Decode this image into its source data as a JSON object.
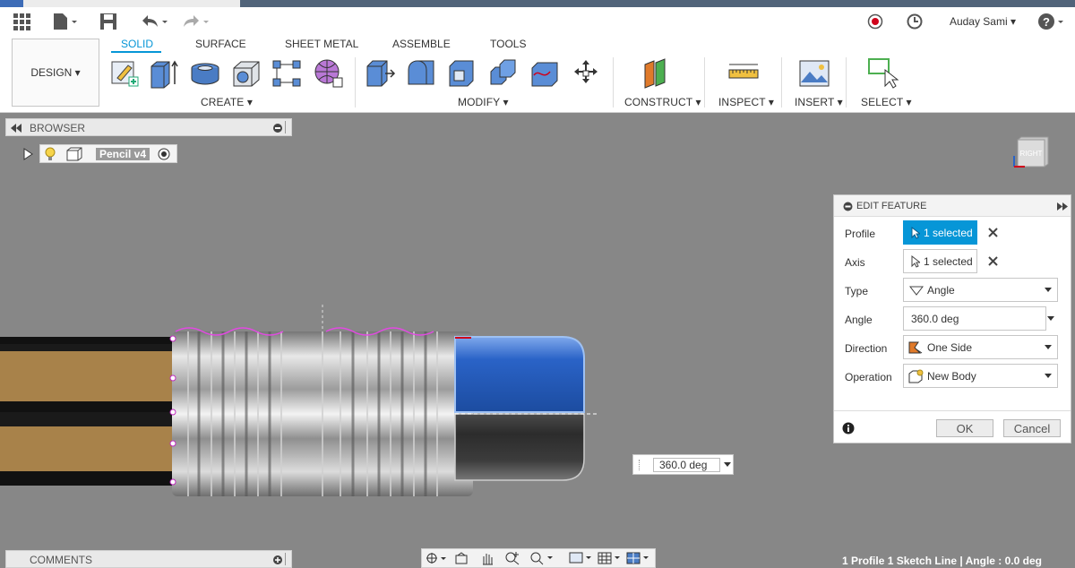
{
  "app": {
    "user": "Auday Sami"
  },
  "workspace": {
    "label": "DESIGN"
  },
  "ribbon": {
    "tabs": [
      "SOLID",
      "SURFACE",
      "SHEET METAL",
      "ASSEMBLE",
      "TOOLS"
    ],
    "active_tab": "SOLID",
    "groups": [
      "CREATE",
      "MODIFY",
      "CONSTRUCT",
      "INSPECT",
      "INSERT",
      "SELECT"
    ],
    "create_icons": [
      "create-sketch-icon",
      "extrude-icon",
      "revolve-icon",
      "hole-icon",
      "form-icon",
      "insert-mesh-icon"
    ],
    "modify_icons": [
      "press-pull-icon",
      "fillet-icon",
      "shell-icon",
      "combine-icon",
      "replace-face-icon",
      "move-icon"
    ]
  },
  "browser": {
    "title": "BROWSER",
    "node_label": "Pencil v4"
  },
  "viewcube": {
    "face_label": "RIGHT"
  },
  "edit_feature": {
    "title": "EDIT FEATURE",
    "rows": [
      {
        "label": "Profile",
        "value": "1 selected",
        "highlighted": true
      },
      {
        "label": "Axis",
        "value": "1 selected",
        "highlighted": false
      },
      {
        "label": "Type",
        "value": "Angle"
      },
      {
        "label": "Angle",
        "value": "360.0 deg"
      },
      {
        "label": "Direction",
        "value": "One Side"
      },
      {
        "label": "Operation",
        "value": "New Body"
      }
    ],
    "ok_label": "OK",
    "cancel_label": "Cancel"
  },
  "angle_tooltip": {
    "value": "360.0 deg"
  },
  "comments": {
    "title": "COMMENTS"
  },
  "status_bar": {
    "text": "1 Profile 1 Sketch Line | Angle : 0.0 deg"
  },
  "colors": {
    "accent": "#0696d7",
    "viewport": "#878787",
    "eraser_blue": "#2a63c7",
    "wood": "#a8824a"
  }
}
